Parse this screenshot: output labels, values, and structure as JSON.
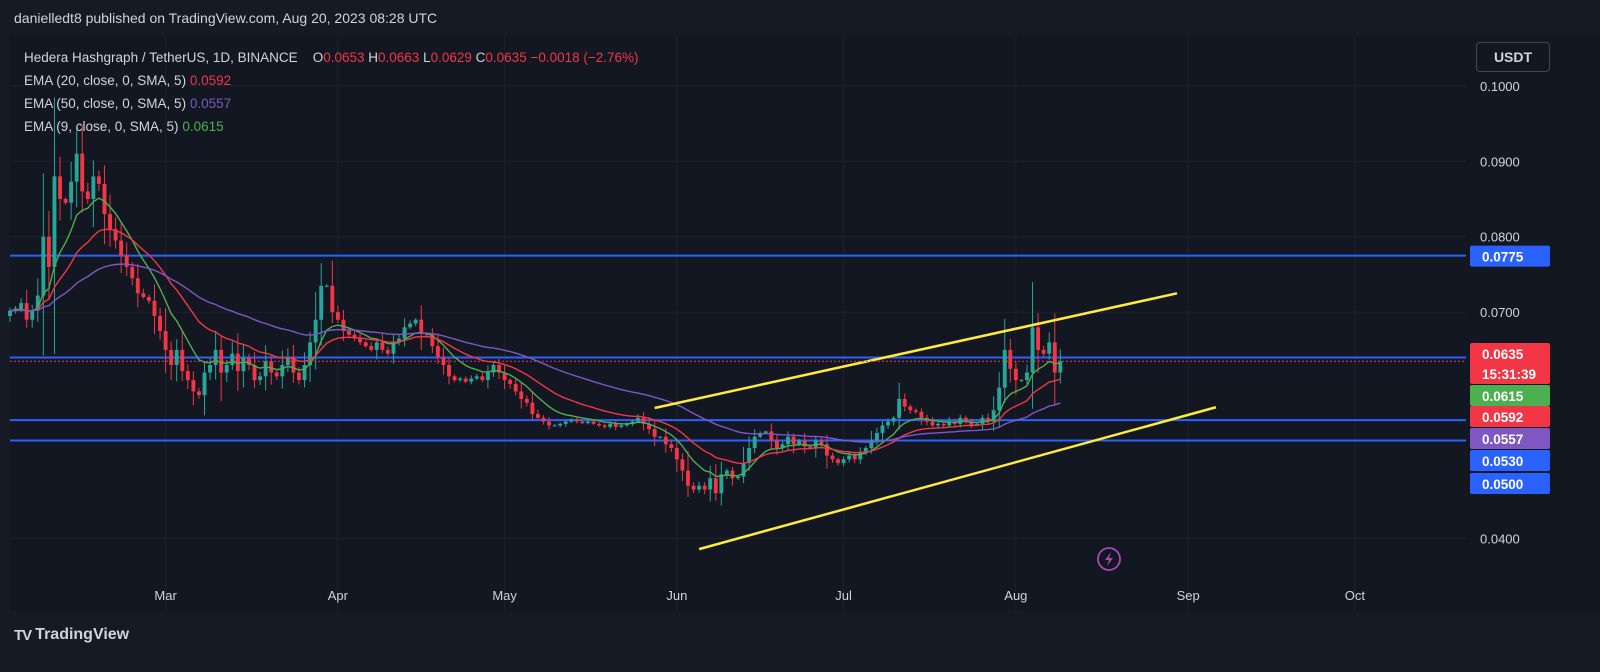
{
  "header": {
    "publish_line": "danielledt8 published on TradingView.com, Aug 20, 2023 08:28 UTC"
  },
  "legend": {
    "symbol": "Hedera Hashgraph / TetherUS, 1D, BINANCE",
    "ohlc": {
      "o_label": "O",
      "o": "0.0653",
      "h_label": "H",
      "h": "0.0663",
      "l_label": "L",
      "l": "0.0629",
      "c_label": "C",
      "c": "0.0635",
      "change": "−0.0018 (−2.76%)"
    },
    "ema20": {
      "label": "EMA (20, close, 0, SMA, 5)",
      "value": "0.0592",
      "color": "#f23645"
    },
    "ema50": {
      "label": "EMA (50, close, 0, SMA, 5)",
      "value": "0.0557",
      "color": "#7e57c2"
    },
    "ema9": {
      "label": "EMA (9, close, 0, SMA, 5)",
      "value": "0.0615",
      "color": "#4caf50"
    }
  },
  "currency_button": "USDT",
  "brand": {
    "name": "TradingView",
    "mark": "TV"
  },
  "colors": {
    "up": "#26a69a",
    "down": "#f23645",
    "level": "#2962ff",
    "channel": "#ffeb3b"
  },
  "chart_data": {
    "type": "candlestick",
    "title": "Hedera Hashgraph / TetherUS, 1D, BINANCE",
    "x_range": [
      "2023-02-01",
      "2023-10-21"
    ],
    "y_range": [
      0.0304,
      0.1066
    ],
    "y_ticks": [
      "0.1000",
      "0.0900",
      "0.0800",
      "0.0700",
      "0.0400"
    ],
    "x_ticks": [
      {
        "label": "Mar",
        "date": "2023-03-01"
      },
      {
        "label": "Apr",
        "date": "2023-04-01"
      },
      {
        "label": "May",
        "date": "2023-05-01"
      },
      {
        "label": "Jun",
        "date": "2023-06-01"
      },
      {
        "label": "Jul",
        "date": "2023-07-01"
      },
      {
        "label": "Aug",
        "date": "2023-08-01"
      },
      {
        "label": "Sep",
        "date": "2023-09-01"
      },
      {
        "label": "Oct",
        "date": "2023-10-01"
      }
    ],
    "horizontal_levels": [
      0.0775,
      0.064,
      0.0557,
      0.053
    ],
    "level_labels": [
      "0.0775",
      "0.0640",
      "0.0530",
      "0.0500"
    ],
    "channel": {
      "upper": [
        [
          "2023-05-28",
          0.0573
        ],
        [
          "2023-08-30",
          0.0725
        ]
      ],
      "lower": [
        [
          "2023-06-05",
          0.0386
        ],
        [
          "2023-09-06",
          0.0574
        ]
      ]
    },
    "last_price": {
      "value": 0.0635,
      "label": "0.0635",
      "countdown": "15:31:39"
    },
    "ema_labels": {
      "ema9": "0.0615",
      "ema20": "0.0592",
      "ema50": "0.0557"
    },
    "series": {
      "close_daily_start": "2023-02-01",
      "close": [
        0.0702,
        0.0705,
        0.0712,
        0.069,
        0.0702,
        0.0722,
        0.08,
        0.076,
        0.088,
        0.085,
        0.0845,
        0.0873,
        0.091,
        0.086,
        0.085,
        0.088,
        0.087,
        0.083,
        0.081,
        0.0795,
        0.0775,
        0.076,
        0.0745,
        0.0725,
        0.072,
        0.0715,
        0.0695,
        0.0675,
        0.065,
        0.063,
        0.065,
        0.0622,
        0.061,
        0.0595,
        0.059,
        0.062,
        0.063,
        0.065,
        0.062,
        0.063,
        0.0645,
        0.0622,
        0.064,
        0.063,
        0.061,
        0.0615,
        0.0635,
        0.062,
        0.0615,
        0.063,
        0.064,
        0.062,
        0.061,
        0.063,
        0.066,
        0.069,
        0.0735,
        0.0735,
        0.07,
        0.069,
        0.0675,
        0.067,
        0.0665,
        0.066,
        0.0655,
        0.065,
        0.066,
        0.065,
        0.0645,
        0.066,
        0.0665,
        0.068,
        0.0685,
        0.069,
        0.0672,
        0.067,
        0.0655,
        0.064,
        0.063,
        0.0615,
        0.061,
        0.0612,
        0.0608,
        0.0612,
        0.0615,
        0.061,
        0.062,
        0.063,
        0.062,
        0.061,
        0.0605,
        0.0595,
        0.0585,
        0.058,
        0.0565,
        0.056,
        0.0555,
        0.055,
        0.055,
        0.0552,
        0.0555,
        0.0558,
        0.0555,
        0.0553,
        0.0555,
        0.0552,
        0.055,
        0.0548,
        0.0552,
        0.0548,
        0.055,
        0.0552,
        0.0555,
        0.056,
        0.0552,
        0.0545,
        0.0535,
        0.0535,
        0.0525,
        0.052,
        0.0505,
        0.049,
        0.047,
        0.0465,
        0.047,
        0.0465,
        0.048,
        0.046,
        0.0485,
        0.049,
        0.048,
        0.0482,
        0.05,
        0.052,
        0.0535,
        0.054,
        0.0542,
        0.053,
        0.052,
        0.0525,
        0.0535,
        0.0525,
        0.053,
        0.0522,
        0.052,
        0.053,
        0.0525,
        0.051,
        0.0505,
        0.05,
        0.0505,
        0.051,
        0.0505,
        0.0515,
        0.052,
        0.053,
        0.054,
        0.055,
        0.0555,
        0.056,
        0.0585,
        0.0575,
        0.057,
        0.0568,
        0.056,
        0.0555,
        0.055,
        0.0552,
        0.055,
        0.0555,
        0.0552,
        0.056,
        0.0555,
        0.055,
        0.0552,
        0.056,
        0.0555,
        0.057,
        0.06,
        0.065,
        0.0625,
        0.061,
        0.061,
        0.062,
        0.068,
        0.065,
        0.0645,
        0.066,
        0.062,
        0.0635
      ]
    }
  }
}
